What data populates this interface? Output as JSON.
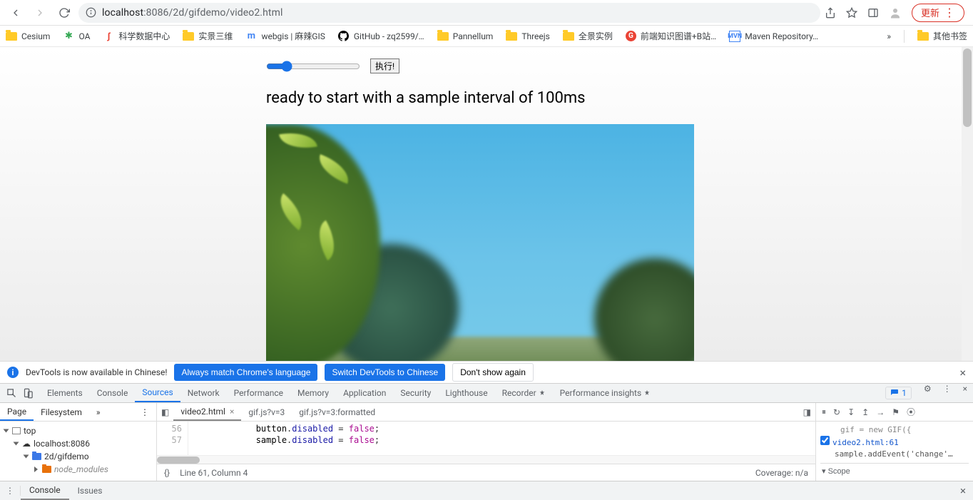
{
  "browser": {
    "url_prefix": "localhost",
    "url_path": ":8086/2d/gifdemo/video2.html",
    "update_label": "更新"
  },
  "bookmarks": [
    {
      "icon": "folder",
      "label": "Cesium"
    },
    {
      "icon": "green",
      "label": "OA"
    },
    {
      "icon": "red",
      "label": "科学数据中心"
    },
    {
      "icon": "folder",
      "label": "实景三维"
    },
    {
      "icon": "blue",
      "label": "webgis | 麻辣GIS"
    },
    {
      "icon": "github",
      "label": "GitHub - zq2599/…"
    },
    {
      "icon": "folder",
      "label": "Pannellum"
    },
    {
      "icon": "folder",
      "label": "Threejs"
    },
    {
      "icon": "folder",
      "label": "全景实例"
    },
    {
      "icon": "redc",
      "label": "前端知识图谱+B站…"
    },
    {
      "icon": "mvn",
      "label": "Maven Repository…"
    }
  ],
  "bookmarks_overflow": "»",
  "bookmarks_other": "其他书签",
  "page": {
    "exec_label": "执行!",
    "status": "ready to start with a sample interval of 100ms"
  },
  "devtools": {
    "lang_msg": "DevTools is now available in Chinese!",
    "always_btn": "Always match Chrome's language",
    "switch_btn": "Switch DevTools to Chinese",
    "dont_btn": "Don't show again",
    "tabs": [
      "Elements",
      "Console",
      "Sources",
      "Network",
      "Performance",
      "Memory",
      "Application",
      "Security",
      "Lighthouse",
      "Recorder",
      "Performance insights"
    ],
    "active_tab": "Sources",
    "issue_count": "1",
    "left_tabs": [
      "Page",
      "Filesystem"
    ],
    "tree": {
      "top": "top",
      "host": "localhost:8086",
      "dir": "2d/gifdemo",
      "node_modules": "node_modules"
    },
    "file_tabs": [
      {
        "label": "video2.html",
        "close": true
      },
      {
        "label": "gif.js?v=3",
        "close": false
      },
      {
        "label": "gif.js?v=3:formatted",
        "close": false
      }
    ],
    "code_lines": [
      {
        "n": "56",
        "t": "            button.disabled = false;"
      },
      {
        "n": "57",
        "t": "            sample.disabled = false;"
      }
    ],
    "status_left": "Line 61, Column 4",
    "status_right": "Coverage: n/a",
    "right": {
      "snippet": "gif = new GIF({",
      "bp_file": "video2.html:61",
      "bp_line": "sample.addEvent('change'…",
      "scope": "Scope"
    },
    "console_tabs": [
      "Console",
      "Issues"
    ]
  }
}
